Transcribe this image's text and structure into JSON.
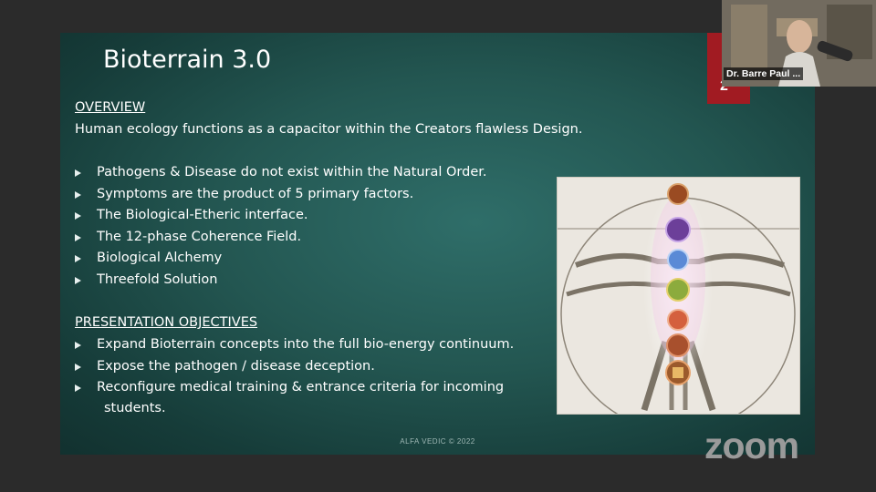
{
  "slide": {
    "title": "Bioterrain 3.0",
    "overview_heading": "OVERVIEW",
    "overview_text": "Human ecology functions as a capacitor within the Creators flawless Design.",
    "overview_bullets": [
      "Pathogens & Disease do not exist within the Natural Order.",
      "Symptoms are the product of 5 primary factors.",
      "The Biological-Etheric interface.",
      "The 12-phase Coherence Field.",
      "Biological Alchemy",
      "Threefold Solution"
    ],
    "objectives_heading": "PRESENTATION OBJECTIVES",
    "objectives_bullets": [
      "Expand Bioterrain concepts into the full bio-energy continuum.",
      "Expose the pathogen / disease deception."
    ],
    "objectives_last_line1": "Reconfigure medical training & entrance criteria for incoming",
    "objectives_last_line2": "students.",
    "footer": "ALFA VEDIC © 2022"
  },
  "slide_number": "2",
  "participant": {
    "name": "Dr. Barre Paul ..."
  },
  "brand": {
    "logo_text": "zoom"
  },
  "colors": {
    "slide_bg": "#235651",
    "accent_red": "#a11b22",
    "text": "#ffffff"
  },
  "icons": {
    "bullet": "triangle-bullet-icon",
    "image": "vitruvian-chakra-image"
  }
}
